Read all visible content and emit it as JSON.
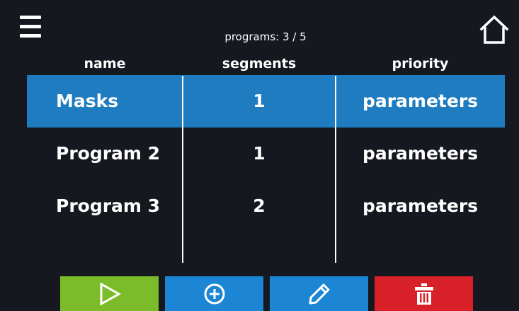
{
  "header": {
    "counter_label": "programs: 3 / 5",
    "menu_icon": "hamburger-menu-icon",
    "home_icon": "home-icon"
  },
  "columns": {
    "name": "name",
    "segments": "segments",
    "priority": "priority"
  },
  "rows": [
    {
      "name": "Masks",
      "segments": "1",
      "priority": "parameters",
      "selected": true
    },
    {
      "name": "Program 2",
      "segments": "1",
      "priority": "parameters",
      "selected": false
    },
    {
      "name": "Program 3",
      "segments": "2",
      "priority": "parameters",
      "selected": false
    }
  ],
  "toolbar": {
    "start_icon": "play-icon",
    "add_icon": "plus-circle-icon",
    "edit_icon": "pencil-icon",
    "delete_icon": "trash-icon"
  },
  "colors": {
    "background": "#15181f",
    "selection": "#1f7cc0",
    "start_button": "#7cbc2a",
    "add_button": "#1c86d4",
    "edit_button": "#1c86d4",
    "delete_button": "#d72027",
    "text": "#ffffff"
  }
}
